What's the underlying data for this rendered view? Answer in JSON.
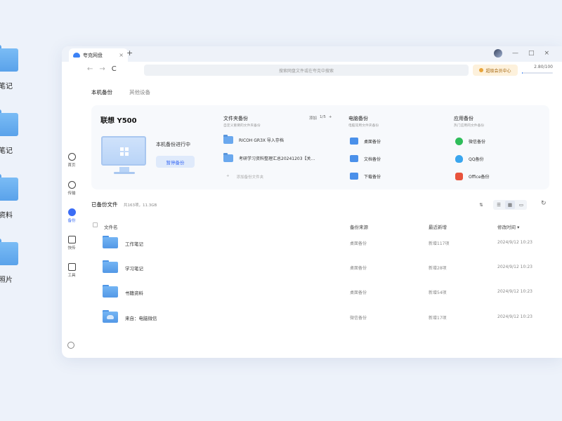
{
  "desktop": {
    "icons": [
      {
        "label": "作笔记"
      },
      {
        "label": "习笔记"
      },
      {
        "label": "籍资料"
      },
      {
        "label": "拍照片"
      }
    ]
  },
  "titlebar": {
    "tab_title": "夸克网盘",
    "new_tab": "+",
    "close_tab": "×",
    "controls": {
      "minimize": "—",
      "maximize": "□",
      "close": "×"
    }
  },
  "navbar": {
    "back": "←",
    "forward": "→",
    "reload": "C",
    "search_placeholder": "搜索网盘文件或在夸克中搜索",
    "vip_label": "超级会员中心",
    "storage": "2.80/100",
    "storage_fraction": 0.028
  },
  "sidebar": {
    "items": [
      {
        "label": "首页",
        "icon": "home-icon"
      },
      {
        "label": "传输",
        "icon": "transfer-icon"
      },
      {
        "label": "备份",
        "icon": "backup-icon",
        "active": true
      },
      {
        "label": "快传",
        "icon": "send-icon"
      },
      {
        "label": "工具",
        "icon": "tools-icon"
      }
    ],
    "bottom_icon": "plus-circle-icon"
  },
  "subtabs": {
    "local": "本机备份",
    "other": "其他设备"
  },
  "device": {
    "name": "联想 Y500",
    "status": "本机备份进行中",
    "pause_label": "暂停备份"
  },
  "folder_backup": {
    "title": "文件夹备份",
    "subtitle": "自定义重要的文件夹备份",
    "add_label": "添加",
    "count": "1/5",
    "plus": "+",
    "folders": [
      "RICOH GR3X 导入存档",
      "考研学习资料整理汇总20241203【关..."
    ],
    "add_folder_label": "添加备份文件夹"
  },
  "pc_backup": {
    "title": "电脑备份",
    "subtitle": "电脑常用文件夹备份",
    "items": [
      "桌面备份",
      "文档备份",
      "下载备份"
    ]
  },
  "app_backup": {
    "title": "应用备份",
    "subtitle": "热门应用的文件备份",
    "items": [
      {
        "label": "微信备份",
        "icon": "wechat-icon",
        "color": "#2fbd5a"
      },
      {
        "label": "QQ备份",
        "icon": "qq-icon",
        "color": "#3aa6ee"
      },
      {
        "label": "Office备份",
        "icon": "office-icon",
        "color": "#e8533c"
      }
    ]
  },
  "files": {
    "title": "已备份文件",
    "count": "共163项，11.3GB",
    "headers": {
      "name": "文件名",
      "source": "备份来源",
      "latest": "最近新增",
      "modified": "修改时间"
    },
    "sort_indicator": "▾",
    "rows": [
      {
        "name": "工作笔记",
        "source": "桌面备份",
        "latest": "新增117项",
        "modified": "2024/9/12 10:23"
      },
      {
        "name": "学习笔记",
        "source": "桌面备份",
        "latest": "新增28项",
        "modified": "2024/9/12 10:23"
      },
      {
        "name": "书籍资料",
        "source": "桌面备份",
        "latest": "新增54项",
        "modified": "2024/9/12 10:23"
      },
      {
        "name": "来自：电脑微信",
        "source": "微信备份",
        "latest": "新增17项",
        "modified": "2024/9/12 10:23"
      }
    ]
  },
  "colors": {
    "accent": "#3b6cf5",
    "folder": "#5fa6ec",
    "vip_bg": "#fdf1dc",
    "vip_text": "#a86a12"
  }
}
